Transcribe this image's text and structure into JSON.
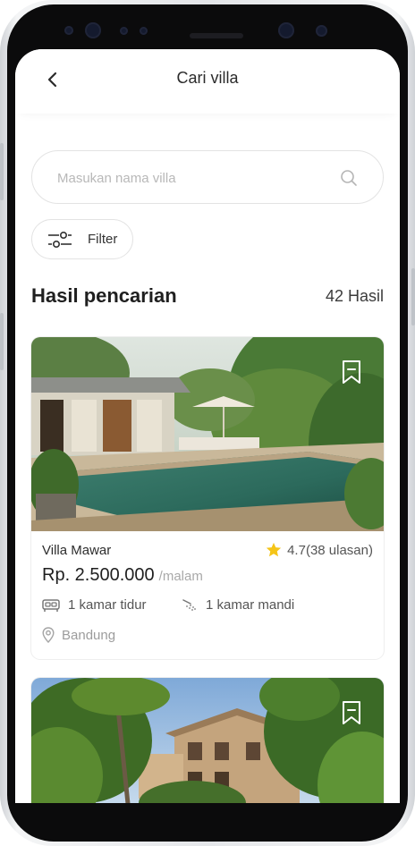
{
  "header": {
    "title": "Cari villa"
  },
  "search": {
    "placeholder": "Masukan nama villa"
  },
  "filter": {
    "label": "Filter"
  },
  "results": {
    "heading": "Hasil pencarian",
    "count": "42 Hasil"
  },
  "villas": [
    {
      "name": "Villa Mawar",
      "rating": "4.7(38 ulasan)",
      "price": "Rp. 2.500.000",
      "price_unit": "/malam",
      "bedrooms": "1 kamar tidur",
      "bathrooms": "1 kamar mandi",
      "location": "Bandung"
    }
  ],
  "colors": {
    "star": "#f5c518",
    "border": "#e3e3e3",
    "text": "#1f1f1f"
  }
}
